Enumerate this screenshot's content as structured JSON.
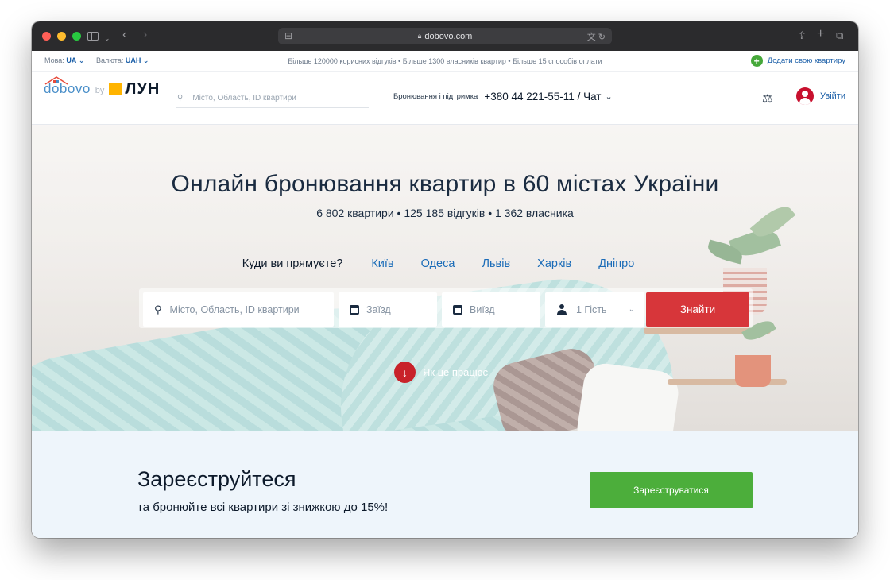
{
  "browser": {
    "url": "dobovo.com"
  },
  "infobar": {
    "lang_label": "Мова:",
    "lang_value": "UA",
    "curr_label": "Валюта:",
    "curr_value": "UAH",
    "promo": "Більше 120000 корисних відгуків • Більше 1300 власників квартир • Більше 15 способів оплати",
    "add_apartment": "Додати свою квартиру"
  },
  "header": {
    "logo_main": "dobovo",
    "logo_by": "by",
    "logo_partner": "ЛУН",
    "search_placeholder": "Місто, Область, ID квартири",
    "support_label": "Бронювання і підтримка",
    "support_phone": "+380 44 221-55-11 / Чат",
    "login_label": "Увійти"
  },
  "hero": {
    "title": "Онлайн бронювання квартир в 60 містах України",
    "subtitle": "6 802 квартири • 125 185 відгуків • 1 362 власника",
    "cities_question": "Куди ви прямуєте?",
    "cities": [
      "Київ",
      "Одеса",
      "Львів",
      "Харків",
      "Дніпро"
    ],
    "search": {
      "city_placeholder": "Місто, Область, ID квартири",
      "checkin_placeholder": "Заїзд",
      "checkout_placeholder": "Виїзд",
      "guests_value": "1 Гість",
      "submit_label": "Знайти"
    },
    "how_it_works": "Як це працює"
  },
  "register": {
    "title": "Зареєструйтеся",
    "subtitle": "та бронюйте всі квартири зі знижкою до 15%!",
    "button_label": "Зареєструватися"
  },
  "colors": {
    "brand_blue": "#1b5fa8",
    "accent_red": "#d7363a",
    "accent_green": "#4cae3b"
  }
}
